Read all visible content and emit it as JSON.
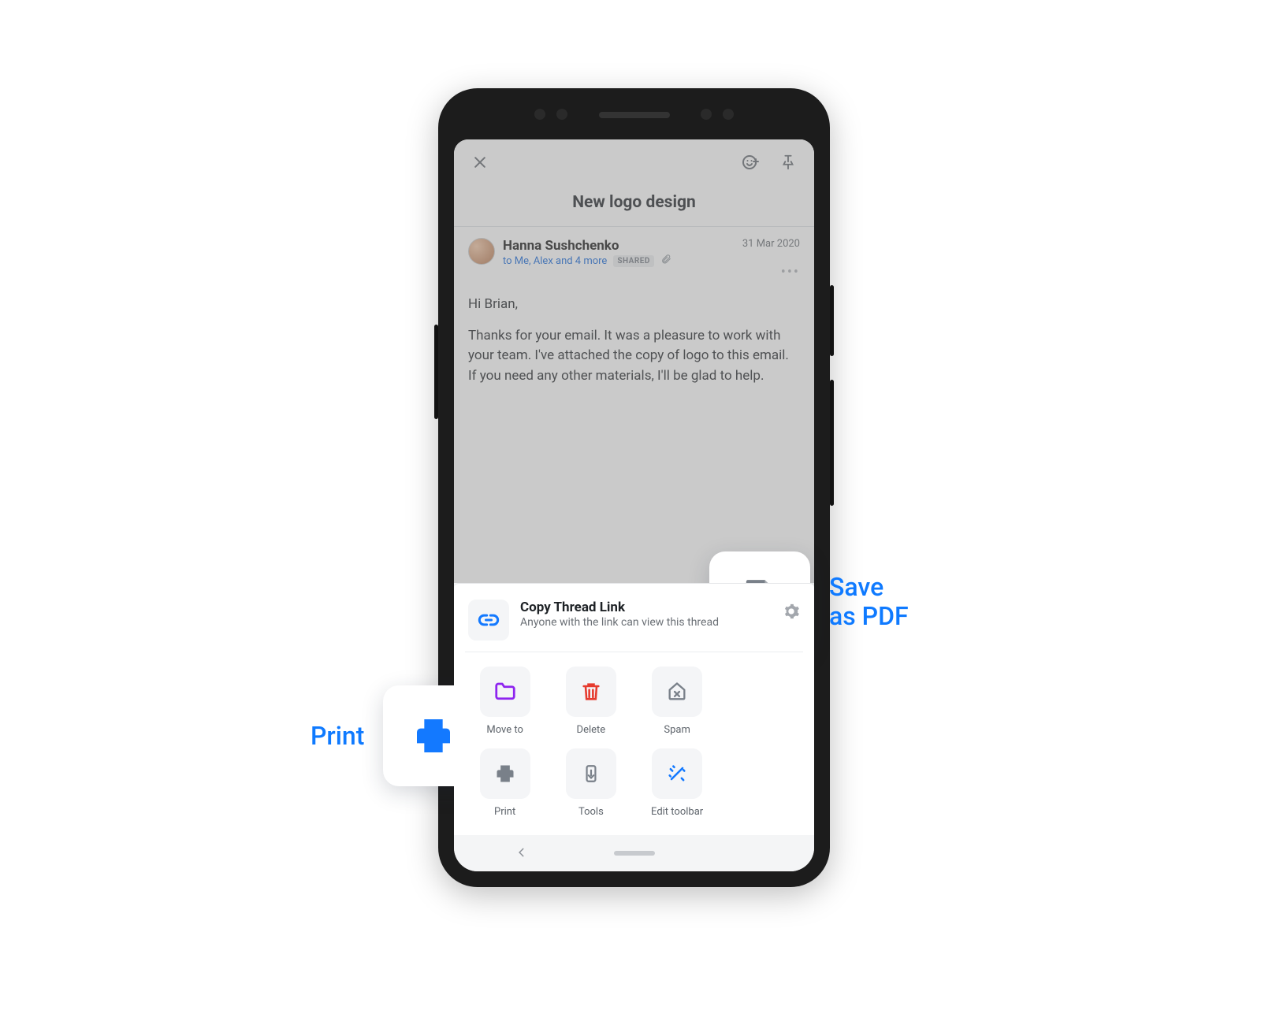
{
  "subject": "New logo design",
  "message": {
    "from_name": "Hanna Sushchenko",
    "to_line": "to Me, Alex and 4 more",
    "shared_badge": "SHARED",
    "date": "31 Mar 2020",
    "greeting": "Hi Brian,",
    "body": "Thanks for your email. It was a pleasure to work with your team. I've attached the copy of logo to this email. If you need any other materials, I'll be glad to help."
  },
  "sheet": {
    "copy": {
      "title": "Copy Thread Link",
      "subtitle": "Anyone with the link can view this thread"
    },
    "actions": {
      "move_to": "Move to",
      "delete": "Delete",
      "spam": "Spam",
      "print": "Print",
      "tools": "Tools",
      "edit_toolbar": "Edit toolbar"
    }
  },
  "callouts": {
    "print": "Print",
    "save_pdf_line1": "Save",
    "save_pdf_line2": "as PDF"
  },
  "colors": {
    "accent": "#0f7aff",
    "folder": "#8e24ef",
    "trash": "#e63b2e",
    "icon_gray": "#798089"
  }
}
